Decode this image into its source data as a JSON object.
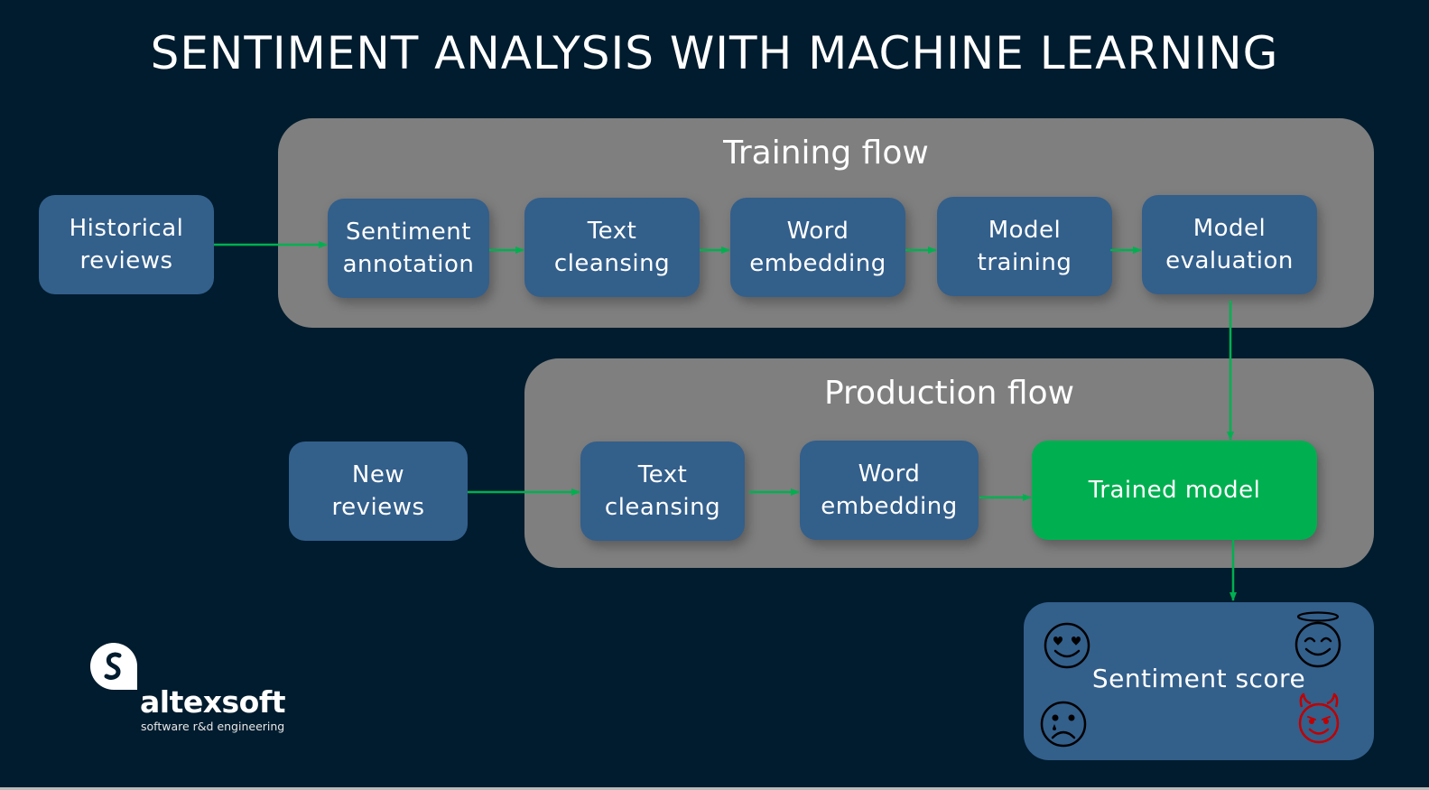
{
  "title": "SENTIMENT ANALYSIS WITH MACHINE LEARNING",
  "training_flow": {
    "title": "Training flow",
    "input": {
      "label": "Historical\nreviews"
    },
    "steps": [
      {
        "label": "Sentiment\nannotation"
      },
      {
        "label": "Text\ncleansing"
      },
      {
        "label": "Word\nembedding"
      },
      {
        "label": "Model\ntraining"
      },
      {
        "label": "Model\nevaluation"
      }
    ]
  },
  "production_flow": {
    "title": "Production flow",
    "input": {
      "label": "New\nreviews"
    },
    "steps": [
      {
        "label": "Text\ncleansing"
      },
      {
        "label": "Word\nembedding"
      },
      {
        "label": "Trained model"
      }
    ]
  },
  "output": {
    "label": "Sentiment score",
    "icons": [
      "heart-eyes-face-icon",
      "angel-face-icon",
      "crying-sad-face-icon",
      "devil-face-icon"
    ]
  },
  "logo": {
    "name": "altexsoft",
    "tagline": "software r&d engineering"
  },
  "colors": {
    "background": "#001c2e",
    "panel": "#7f7f7f",
    "node": "#335f8b",
    "highlight": "#00b050",
    "arrow": "#00b050",
    "devil": "#c00000"
  }
}
